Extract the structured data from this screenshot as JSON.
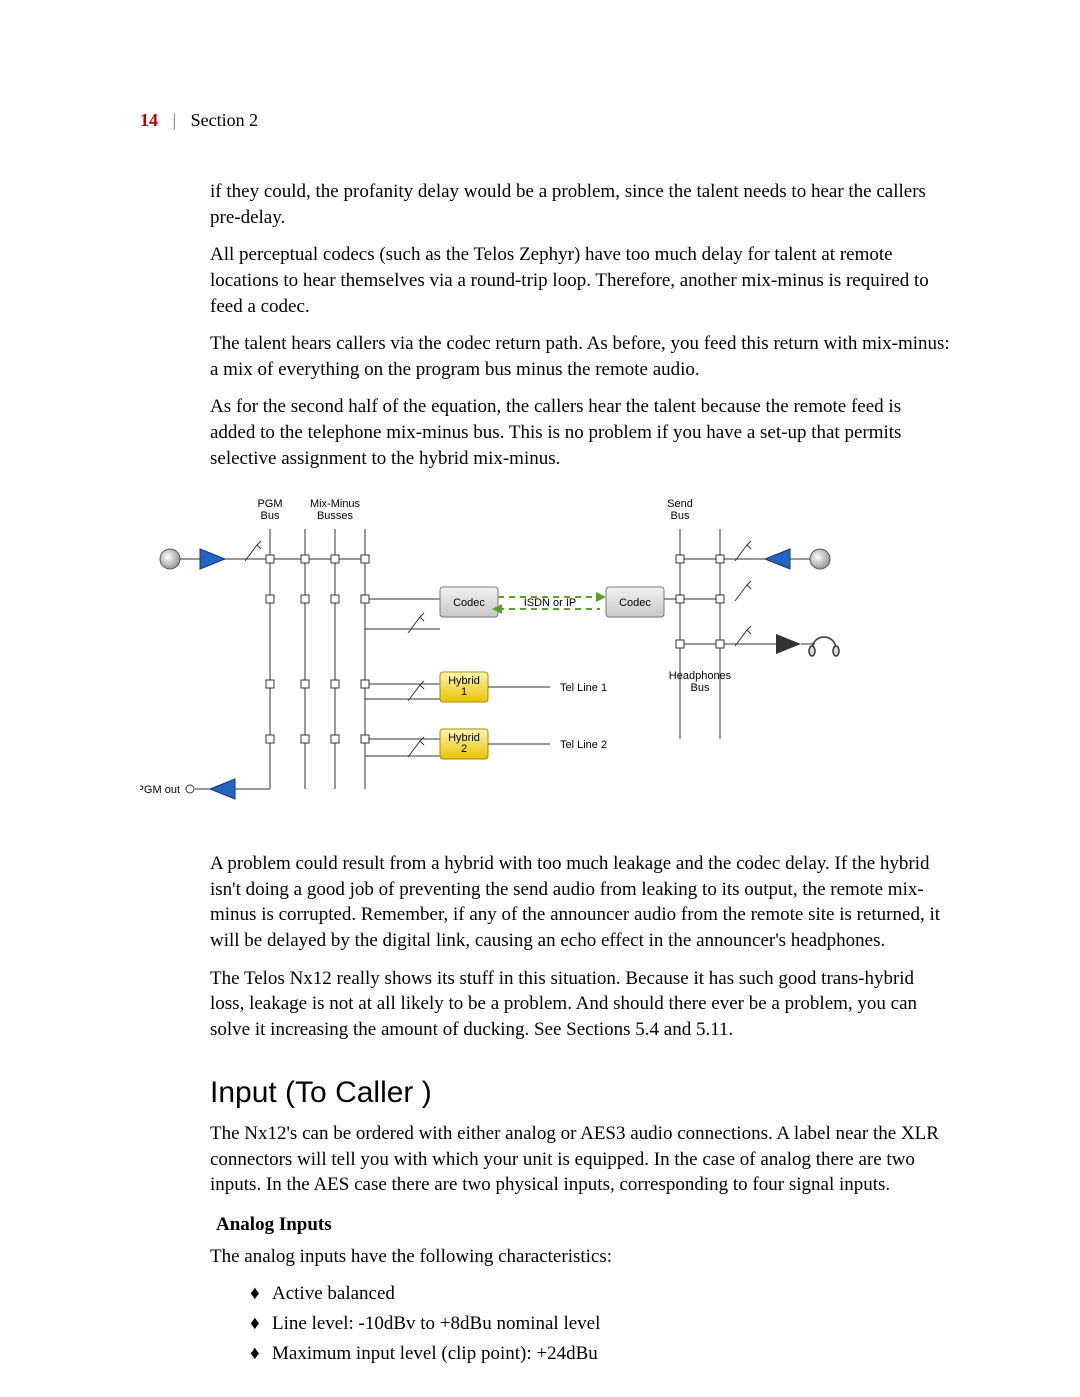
{
  "header": {
    "page_number": "14",
    "section": "Section 2"
  },
  "paragraphs": {
    "p1": "if they could, the profanity delay would be a problem, since the talent needs to hear the callers pre-delay.",
    "p2": "All perceptual codecs (such as the Telos Zephyr) have too much delay for talent at remote locations to hear themselves via a round-trip loop. Therefore, another mix-minus is required to feed a codec.",
    "p3": "The talent hears callers via the codec return path. As before, you feed this return with mix-minus: a mix of everything on the program bus minus the remote audio.",
    "p4": "As for the second half of the equation, the callers hear the talent because the remote feed is added to the telephone mix-minus bus. This is no problem if you have a set-up that permits selective assignment to the hybrid mix-minus.",
    "p5": "A problem could result from a hybrid with too much leakage and the codec delay. If the hybrid isn't doing a good job of preventing the send audio from leaking to its output, the remote mix-minus is corrupted. Remember, if any of the announcer audio from the remote site is returned, it will be delayed by the digital link, causing an echo effect in the announcer's headphones.",
    "p6": "The Telos Nx12 really shows its stuff in this situation. Because it has such good trans-hybrid loss, leakage is not at all likely to be a problem. And should there ever be a problem, you can solve it increasing the amount of ducking. See Sections 5.4 and 5.11.",
    "p7": "The Nx12's can be ordered with either analog or AES3 audio connections. A label near the XLR connectors will tell you with which your unit is equipped. In the case of analog there are two inputs. In the AES case there are two physical inputs, corresponding to four signal inputs.",
    "p8": "The analog inputs have the following characteristics:"
  },
  "section_title": "Input (To Caller )",
  "subhead": "Analog Inputs",
  "bullets": {
    "b1": "Active balanced",
    "b2": "Line level: -10dBv to +8dBu nominal level",
    "b3": "Maximum input level (clip point): +24dBu"
  },
  "diagram": {
    "pgm_bus": "PGM\nBus",
    "mix_minus": "Mix-Minus\nBusses",
    "send_bus": "Send\nBus",
    "codec_l": "Codec",
    "codec_r": "Codec",
    "link": "ISDN or IP",
    "hybrid1": "Hybrid\n1",
    "hybrid2": "Hybrid\n2",
    "telline1": "Tel Line 1",
    "telline2": "Tel Line 2",
    "headphones_bus": "Headphones\nBus",
    "pgm_out": "PGM out"
  }
}
